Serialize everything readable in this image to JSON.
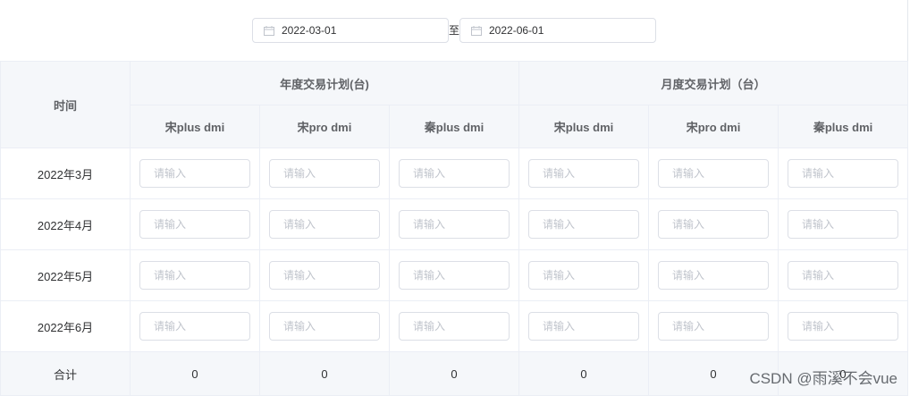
{
  "date_range": {
    "start": "2022-03-01",
    "separator": "至",
    "end": "2022-06-01",
    "icon": "calendar-icon"
  },
  "table": {
    "time_header": "时间",
    "group_headers": [
      "年度交易计划(台)",
      "月度交易计划（台）"
    ],
    "sub_headers": [
      "宋plus dmi",
      "宋pro dmi",
      "秦plus dmi",
      "宋plus dmi",
      "宋pro dmi",
      "秦plus dmi"
    ],
    "rows": [
      {
        "month": "2022年3月"
      },
      {
        "month": "2022年4月"
      },
      {
        "month": "2022年5月"
      },
      {
        "month": "2022年6月"
      }
    ],
    "input_placeholder": "请输入",
    "total_label": "合计",
    "totals": [
      "0",
      "0",
      "0",
      "0",
      "0",
      "0"
    ]
  },
  "watermark": "CSDN @雨溪不会vue",
  "colors": {
    "header_bg": "#f5f7fa",
    "border": "#ebeef5",
    "input_border": "#dcdfe6",
    "placeholder": "#c0c4cc"
  }
}
